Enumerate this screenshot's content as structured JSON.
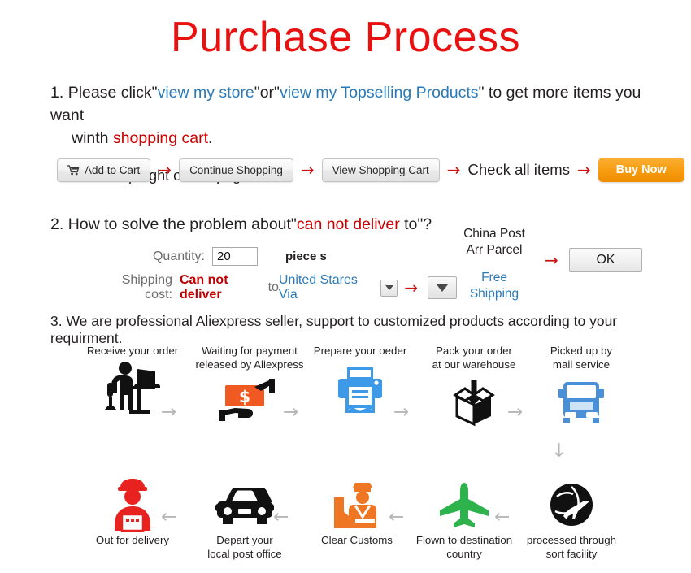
{
  "title": "Purchase Process",
  "colors": {
    "title_red": "#e8110f",
    "link_blue": "#2a7ab9",
    "alert_red": "#cc0000",
    "buy_orange": "#f79d12",
    "arrow_gray": "#b7b7b7"
  },
  "step1": {
    "number": "1.",
    "text_a": "Please click\"",
    "link_store": "view my store",
    "text_b": "\"or\"",
    "link_topselling": "view my Topselling Products",
    "text_c": "\" to get more items you want",
    "text_d": "winth ",
    "highlight_cart": "shopping cart",
    "text_e": ".",
    "subtitle": "on the top right of webpage:",
    "buttons": {
      "add_to_cart": "Add to Cart",
      "continue_shopping": "Continue Shopping",
      "view_shopping_cart": "View Shopping Cart",
      "check_all_items": "Check all items",
      "buy_now": "Buy Now"
    },
    "arrow": "→"
  },
  "step2": {
    "number": "2.",
    "text_a": "How to solve the problem about\"",
    "highlight": "can not deliver",
    "text_b": " to\"?",
    "quantity_label": "Quantity:",
    "quantity_value": "20",
    "piece_label": "piece s",
    "shipping_label": "Shipping cost:",
    "shipping_alert": "Can not deliver",
    "shipping_to": " to ",
    "shipping_country": "United Stares Via",
    "carrier_line1": "China Post",
    "carrier_line2": "Arr Parcel",
    "free_line1": "Free",
    "free_line2": "Shipping",
    "ok_label": "OK",
    "arrow": "→"
  },
  "step3": {
    "number": "3.",
    "text": "We are professional Aliexpress seller, support to customized products according to your requirment.",
    "row1": [
      {
        "label_line1": "Receive your order",
        "label_line2": "",
        "icon": "person-at-desk-icon"
      },
      {
        "label_line1": "Waiting for payment",
        "label_line2": "released by Aliexpress",
        "icon": "money-hand-icon"
      },
      {
        "label_line1": "Prepare your oeder",
        "label_line2": "",
        "icon": "printer-icon"
      },
      {
        "label_line1": "Pack your order",
        "label_line2": "at our warehouse",
        "icon": "packing-box-icon"
      },
      {
        "label_line1": "Picked up by",
        "label_line2": "mail service",
        "icon": "truck-icon"
      }
    ],
    "row2": [
      {
        "label_line1": "Out for delivery",
        "label_line2": "",
        "icon": "delivery-person-icon"
      },
      {
        "label_line1": "Depart your",
        "label_line2": "local post office",
        "icon": "car-icon"
      },
      {
        "label_line1": "Clear Customs",
        "label_line2": "",
        "icon": "customs-officer-icon"
      },
      {
        "label_line1": "Flown to destination",
        "label_line2": "country",
        "icon": "airplane-icon"
      },
      {
        "label_line1": "processed through",
        "label_line2": "sort facility",
        "icon": "globe-plane-icon"
      }
    ],
    "arrow_right": "→",
    "arrow_left": "←",
    "arrow_down": "↓"
  }
}
